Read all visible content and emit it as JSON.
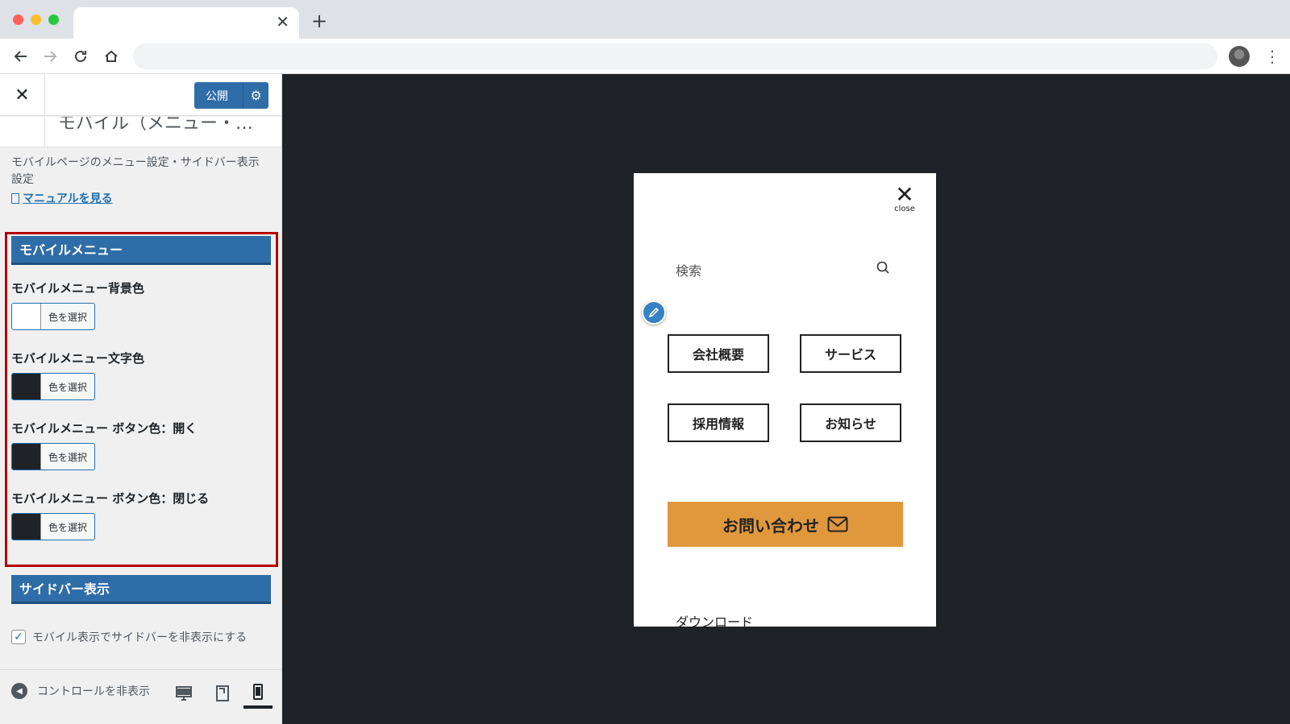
{
  "browser": {
    "tab_close": "✕",
    "new_tab": "+"
  },
  "sidebar": {
    "close": "✕",
    "publish_label": "公開",
    "section_title": "モバイル（メニュー・…",
    "description": "モバイルページのメニュー設定・サイドバー表示設定",
    "manual_link": "マニュアルを見る",
    "mobile_menu": {
      "header": "モバイルメニュー",
      "controls": [
        {
          "label": "モバイルメニュー背景色",
          "button": "色を選択",
          "color": "#ffffff"
        },
        {
          "label": "モバイルメニュー文字色",
          "button": "色を選択",
          "color": "#1f2327"
        },
        {
          "label": "モバイルメニュー ボタン色：開く",
          "button": "色を選択",
          "color": "#1f2327"
        },
        {
          "label": "モバイルメニュー ボタン色：閉じる",
          "button": "色を選択",
          "color": "#1f2327"
        }
      ]
    },
    "sidebar_display": {
      "header": "サイドバー表示",
      "checkbox_label": "モバイル表示でサイドバーを非表示にする",
      "checked": true
    },
    "footer": {
      "collapse_label": "コントロールを非表示"
    }
  },
  "preview": {
    "close_label": "close",
    "search_placeholder": "検索",
    "menu_items": [
      "会社概要",
      "サービス",
      "採用情報",
      "お知らせ"
    ],
    "contact_button": "お問い合わせ",
    "download_label": "ダウンロード",
    "accent_color": "#e0983d",
    "background_color": "#1f2327"
  }
}
